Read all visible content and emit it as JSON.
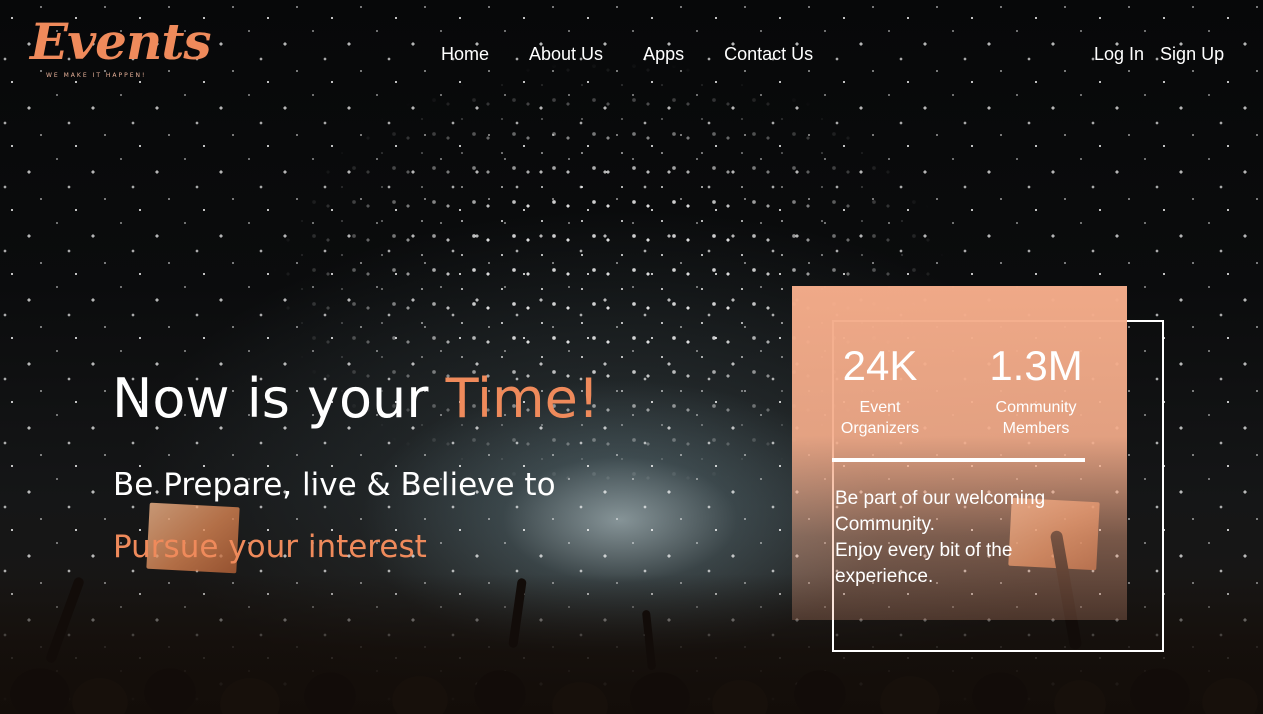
{
  "brand": {
    "name": "Events",
    "tagline": "WE MAKE IT HAPPEN!"
  },
  "nav": {
    "items": [
      "Home",
      "About Us",
      "Apps",
      "Contact Us"
    ]
  },
  "auth": {
    "login": "Log In",
    "signup": "Sign Up"
  },
  "hero": {
    "headline_main": "Now is your ",
    "headline_accent": "Time!",
    "subline_1": "Be Prepare, live & Believe to",
    "subline_2": "Pursue your interest"
  },
  "stats_card": {
    "stats": [
      {
        "value": "24K",
        "label_line1": "Event",
        "label_line2": "Organizers"
      },
      {
        "value": "1.3M",
        "label_line1": "Community",
        "label_line2": "Members"
      }
    ],
    "text_line_1": "Be part of our welcoming Community.",
    "text_line_2": "Enjoy every bit of the experience."
  },
  "colors": {
    "accent": "#ef8a5b",
    "card": "#f4ac8a",
    "text": "#ffffff"
  }
}
